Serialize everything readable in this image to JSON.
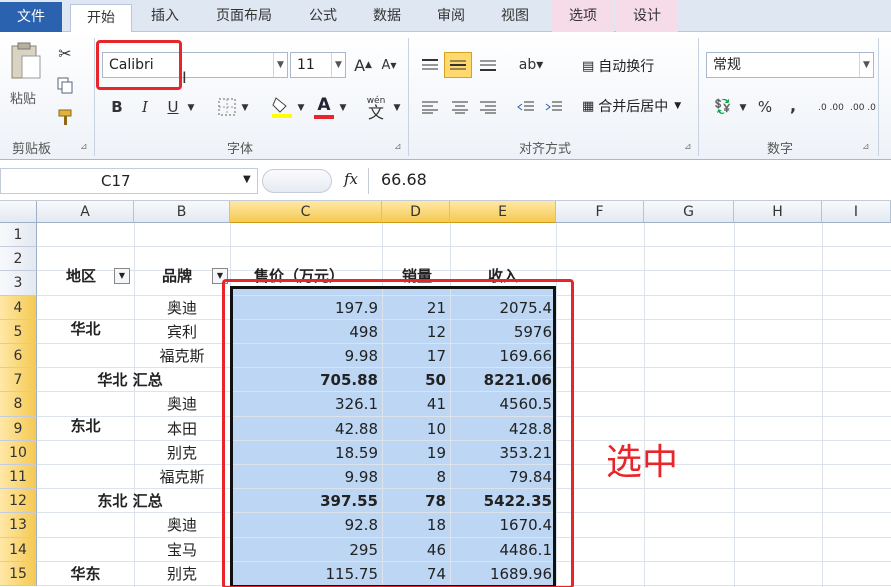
{
  "tabs": [
    "文件",
    "开始",
    "插入",
    "页面布局",
    "公式",
    "数据",
    "审阅",
    "视图",
    "选项",
    "设计"
  ],
  "clipboard": {
    "paste": "粘贴",
    "label": "剪贴板"
  },
  "font": {
    "name": "Calibri",
    "size": "11",
    "grow": "A",
    "shrink": "A",
    "bold": "B",
    "italic": "I",
    "underline": "U",
    "label": "字体",
    "wen": "wén",
    "wen_char": "文"
  },
  "align": {
    "wrap": "自动换行",
    "merge": "合并后居中",
    "label": "对齐方式"
  },
  "number": {
    "format": "常规",
    "percent": "%",
    "comma": ",",
    "inc": ".0 .00",
    "dec": ".00 .0",
    "label": "数字"
  },
  "formula_bar": {
    "name_box": "C17",
    "fx": "fx",
    "value": "66.68"
  },
  "columns": [
    "A",
    "B",
    "C",
    "D",
    "E",
    "F",
    "G",
    "H",
    "I"
  ],
  "rows": [
    "1",
    "2",
    "3",
    "4",
    "5",
    "6",
    "7",
    "8",
    "9",
    "10",
    "11",
    "12",
    "13",
    "14",
    "15"
  ],
  "headers": {
    "region": "地区",
    "brand": "品牌",
    "price": "售价（万元）",
    "qty": "销量",
    "revenue": "收入"
  },
  "data_rows": [
    {
      "region": "华北",
      "brand": "奥迪",
      "price": "197.9",
      "qty": "21",
      "rev": "2075.4"
    },
    {
      "region": "",
      "brand": "宾利",
      "price": "498",
      "qty": "12",
      "rev": "5976"
    },
    {
      "region": "",
      "brand": "福克斯",
      "price": "9.98",
      "qty": "17",
      "rev": "169.66"
    },
    {
      "region": "华北 汇总",
      "brand": "",
      "price": "705.88",
      "qty": "50",
      "rev": "8221.06",
      "total": true
    },
    {
      "region": "东北",
      "brand": "奥迪",
      "price": "326.1",
      "qty": "41",
      "rev": "4560.5"
    },
    {
      "region": "",
      "brand": "本田",
      "price": "42.88",
      "qty": "10",
      "rev": "428.8"
    },
    {
      "region": "",
      "brand": "别克",
      "price": "18.59",
      "qty": "19",
      "rev": "353.21"
    },
    {
      "region": "",
      "brand": "福克斯",
      "price": "9.98",
      "qty": "8",
      "rev": "79.84"
    },
    {
      "region": "东北 汇总",
      "brand": "",
      "price": "397.55",
      "qty": "78",
      "rev": "5422.35",
      "total": true
    },
    {
      "region": "",
      "brand": "奥迪",
      "price": "92.8",
      "qty": "18",
      "rev": "1670.4"
    },
    {
      "region": "",
      "brand": "宝马",
      "price": "295",
      "qty": "46",
      "rev": "4486.1"
    },
    {
      "region": "华东",
      "brand": "别克",
      "price": "115.75",
      "qty": "74",
      "rev": "1689.96"
    }
  ],
  "annotation": "选中",
  "colors": {
    "accent": "#e8252a",
    "selection": "#bcd6f3",
    "file_tab": "#2b62b0"
  }
}
